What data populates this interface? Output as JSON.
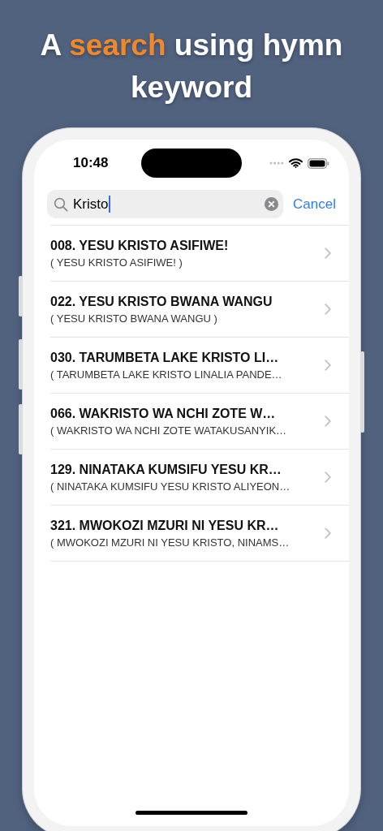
{
  "headline": [
    {
      "text": "A ",
      "highlight": false
    },
    {
      "text": "search",
      "highlight": true
    },
    {
      "text": " using hymn keyword",
      "highlight": false
    }
  ],
  "status_bar": {
    "time": "10:48"
  },
  "search": {
    "value": "Kristo",
    "cancel": "Cancel"
  },
  "results": [
    {
      "title": "008. YESU KRISTO ASIFIWE!",
      "subtitle": "( YESU KRISTO ASIFIWE! )"
    },
    {
      "title": "022. YESU KRISTO BWANA WANGU",
      "subtitle": "( YESU KRISTO BWANA WANGU )"
    },
    {
      "title": "030. TARUMBETA LAKE KRISTO LI…",
      "subtitle": "( TARUMBETA LAKE KRISTO LINALIA PANDE…"
    },
    {
      "title": "066. WAKRISTO WA NCHI ZOTE W…",
      "subtitle": "( WAKRISTO WA NCHI ZOTE WATAKUSANYIK…"
    },
    {
      "title": "129. NINATAKA KUMSIFU YESU KR…",
      "subtitle": "( NINATAKA KUMSIFU YESU KRISTO ALIYEON…"
    },
    {
      "title": "321. MWOKOZI MZURI NI YESU KR…",
      "subtitle": "( MWOKOZI MZURI NI YESU KRISTO, NINAMS…"
    }
  ]
}
